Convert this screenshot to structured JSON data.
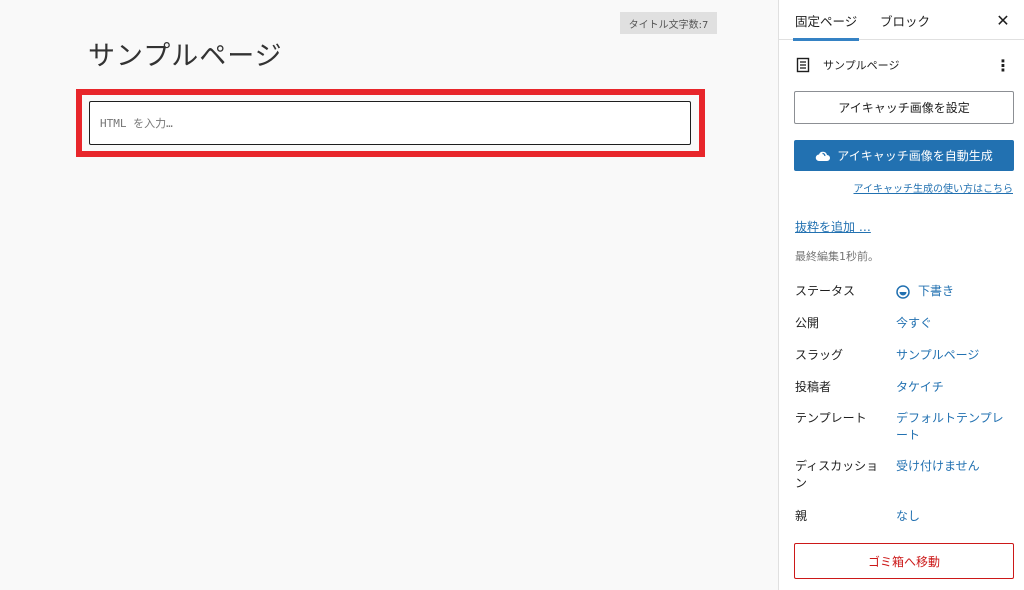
{
  "editor": {
    "char_count": "タイトル文字数:7",
    "title": "サンプルページ",
    "html_placeholder": "HTML を入力…",
    "highlight_color": "#e8262b"
  },
  "sidebar": {
    "tabs": [
      {
        "label": "固定ページ",
        "active": true
      },
      {
        "label": "ブロック",
        "active": false
      }
    ],
    "close_icon": "close-icon",
    "document": {
      "icon": "page-icon",
      "title": "サンプルページ",
      "more_icon": "more-vertical-icon"
    },
    "featured_image_button": "アイキャッチ画像を設定",
    "auto_generate_button": "アイキャッチ画像を自動生成",
    "auto_generate_icon": "cloud-icon",
    "help_link": "アイキャッチ生成の使い方はこちら",
    "excerpt_link": "抜粋を追加 …",
    "last_edited": "最終編集1秒前。",
    "meta": [
      {
        "label": "ステータス",
        "value": "下書き"
      },
      {
        "label": "公開",
        "value": "今すぐ"
      },
      {
        "label": "スラッグ",
        "value": "サンプルページ"
      },
      {
        "label": "投稿者",
        "value": "タケイチ"
      },
      {
        "label": "テンプレート",
        "value": "デフォルトテンプレート"
      },
      {
        "label": "ディスカッション",
        "value": "受け付けません"
      },
      {
        "label": "親",
        "value": "なし"
      }
    ],
    "trash_button": "ゴミ箱へ移動",
    "colors": {
      "accent": "#2271b1",
      "danger": "#cc1818"
    }
  }
}
